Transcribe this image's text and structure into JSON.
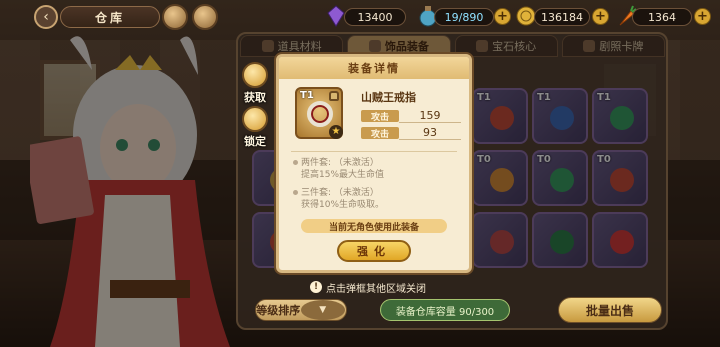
{
  "header": {
    "title": "仓库",
    "resources": [
      {
        "name": "crystal",
        "value": "13400",
        "icon": "purple-crystal-icon"
      },
      {
        "name": "stamina",
        "value": "19/890",
        "icon": "potion-icon"
      },
      {
        "name": "gold",
        "value": "136184",
        "icon": "gold-coin-icon"
      },
      {
        "name": "carrot",
        "value": "1364",
        "icon": "carrot-icon"
      }
    ]
  },
  "tabs": [
    {
      "label": "道具材料",
      "active": false
    },
    {
      "label": "饰品装备",
      "active": true
    },
    {
      "label": "宝石核心",
      "active": false
    },
    {
      "label": "剧照卡牌",
      "active": false
    }
  ],
  "side_actions": {
    "obtain": "获取",
    "lock": "锁定"
  },
  "popup": {
    "title": "装备详情",
    "item": {
      "tier": "T1",
      "name": "山贼王戒指",
      "stats": [
        {
          "label": "攻击",
          "value": "159"
        },
        {
          "label": "攻击",
          "value": "93"
        }
      ]
    },
    "set_bonus": [
      {
        "line1": "两件套: （未激活）",
        "line2": "提高15%最大生命值"
      },
      {
        "line1": "三件套: （未激活）",
        "line2": "获得10%生命吸取。"
      }
    ],
    "notice": "当前无角色使用此装备",
    "enhance": "强化"
  },
  "grid": {
    "tiers": [
      "T1",
      "T1",
      "T1",
      "T0",
      "T0",
      "T0",
      "",
      "",
      "",
      "",
      "",
      ""
    ]
  },
  "footer": {
    "hint": "点击弹框其他区域关闭",
    "sort_label": "等级排序",
    "capacity": "装备仓库容量 90/300",
    "bulk_sell": "批量出售"
  },
  "colors": {
    "popup_bg": "#f7ecd3",
    "accent_gold": "#e1a726",
    "panel_bg": "#554234"
  }
}
